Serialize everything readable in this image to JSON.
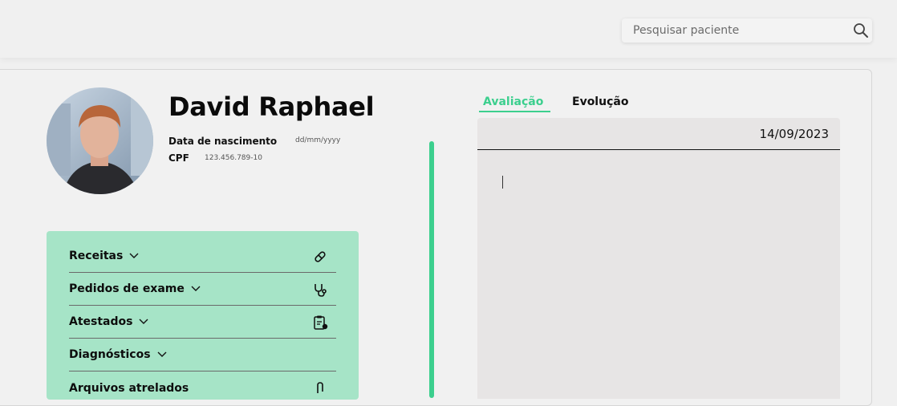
{
  "search": {
    "placeholder": "Pesquisar paciente"
  },
  "patient": {
    "name": "David Raphael",
    "birth_label": "Data de nascimento",
    "birth_value": "dd/mm/yyyy",
    "cpf_label": "CPF",
    "cpf_value": "123.456.789-10"
  },
  "menu": {
    "items": [
      {
        "label": "Receitas",
        "icon": "pill-icon"
      },
      {
        "label": "Pedidos de exame",
        "icon": "stethoscope-icon"
      },
      {
        "label": "Atestados",
        "icon": "clipboard-icon"
      },
      {
        "label": "Diagnósticos",
        "icon": ""
      },
      {
        "label": "Arquivos atrelados",
        "icon": "paperclip-icon"
      }
    ]
  },
  "tabs": {
    "active": "Avaliação",
    "inactive": "Evolução"
  },
  "editor": {
    "date": "14/09/2023"
  },
  "colors": {
    "accent": "#3ccf8e",
    "panel": "#a6e4c7",
    "editor_bg": "#e7e5e5"
  }
}
